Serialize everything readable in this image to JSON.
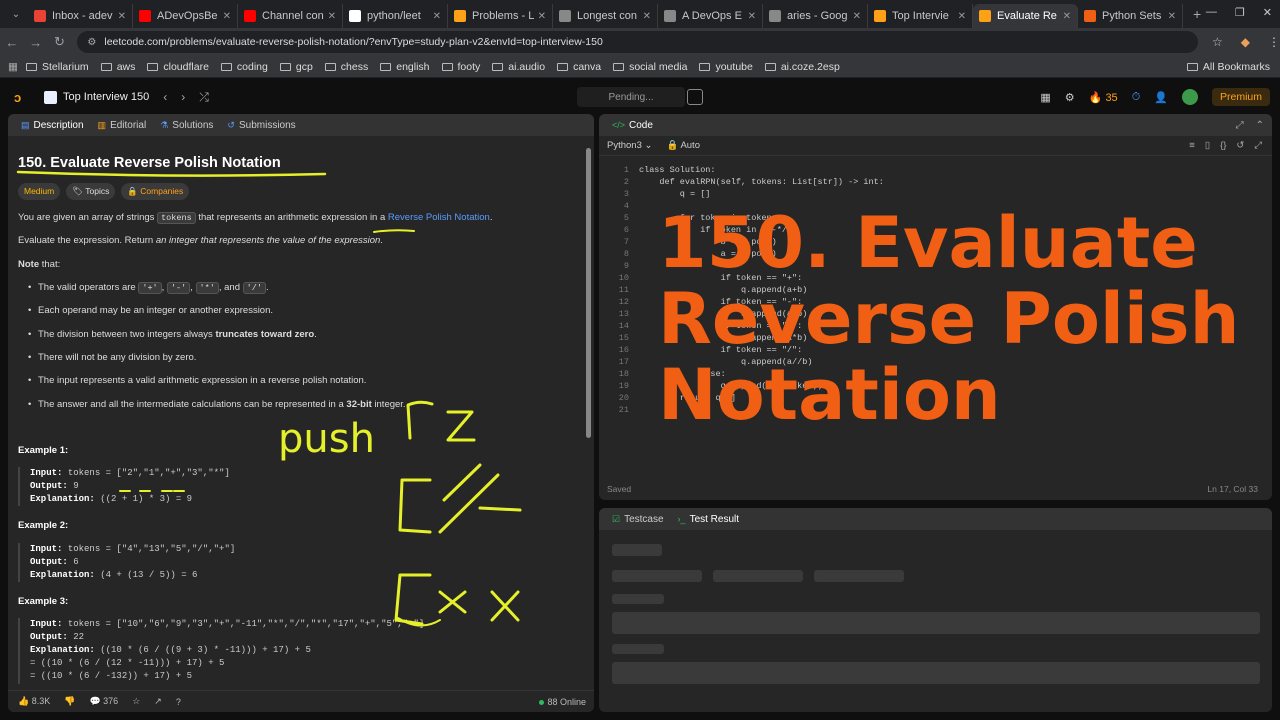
{
  "browser": {
    "tabs": [
      {
        "label": "Inbox - adev",
        "color": "#ea4335"
      },
      {
        "label": "ADevOpsBe",
        "color": "#ff0000"
      },
      {
        "label": "Channel con",
        "color": "#ff0000"
      },
      {
        "label": "python/leet",
        "color": "#ffffff"
      },
      {
        "label": "Problems - L",
        "color": "#ffa116"
      },
      {
        "label": "Longest con",
        "color": "#888888"
      },
      {
        "label": "A DevOps E",
        "color": "#888888"
      },
      {
        "label": "aries - Goog",
        "color": "#888888"
      },
      {
        "label": "Top Intervie",
        "color": "#ffa116"
      },
      {
        "label": "Evaluate Re",
        "color": "#ffa116",
        "active": true
      },
      {
        "label": "Python Sets",
        "color": "#f05f14"
      }
    ],
    "url": "leetcode.com/problems/evaluate-reverse-polish-notation/?envType=study-plan-v2&envId=top-interview-150",
    "bookmarks": [
      "Stellarium",
      "aws",
      "cloudflare",
      "coding",
      "gcp",
      "chess",
      "english",
      "footy",
      "ai.audio",
      "canva",
      "social media",
      "youtube",
      "ai.coze.2esp"
    ],
    "all_bookmarks": "All Bookmarks"
  },
  "lc_header": {
    "list_title": "Top Interview 150",
    "pending": "Pending...",
    "streak": "35",
    "premium": "Premium"
  },
  "desc_tabs": [
    "Description",
    "Editorial",
    "Solutions",
    "Submissions"
  ],
  "problem": {
    "title": "150. Evaluate Reverse Polish Notation",
    "difficulty": "Medium",
    "topics": "Topics",
    "companies": "Companies",
    "intro_a": "You are given an array of strings ",
    "intro_code": "tokens",
    "intro_b": " that represents an arithmetic expression in a ",
    "intro_link": "Reverse Polish Notation",
    "intro_c": ".",
    "eval_a": "Evaluate the expression. Return ",
    "eval_i": "an integer that represents the value of the expression",
    "eval_c": ".",
    "note_b": "Note",
    "note_rest": " that:",
    "ops_a": "The valid operators are ",
    "op1": "'+'",
    "op2": "'-'",
    "op3": "'*'",
    "ops_and": ", and ",
    "op4": "'/'",
    "bullet2": "Each operand may be an integer or another expression.",
    "bullet3_a": "The division between two integers always ",
    "bullet3_b": "truncates toward zero",
    "bullet3_c": ".",
    "bullet4": "There will not be any division by zero.",
    "bullet5": "The input represents a valid arithmetic expression in a reverse polish notation.",
    "bullet6_a": "The answer and all the intermediate calculations can be represented in a ",
    "bullet6_b": "32-bit",
    "bullet6_c": " integer.",
    "examples": [
      {
        "h": "Example 1:",
        "input": "tokens = [\"2\",\"1\",\"+\",\"3\",\"*\"]",
        "output": "9",
        "expl": "((2 + 1) * 3) = 9"
      },
      {
        "h": "Example 2:",
        "input": "tokens = [\"4\",\"13\",\"5\",\"/\",\"+\"]",
        "output": "6",
        "expl": "(4 + (13 / 5)) = 6"
      },
      {
        "h": "Example 3:",
        "input": "tokens = [\"10\",\"6\",\"9\",\"3\",\"+\",\"-11\",\"*\",\"/\",\"*\",\"17\",\"+\",\"5\",\"+\"]",
        "output": "22",
        "expl": "((10 * (6 / ((9 + 3) * -11))) + 17) + 5"
      }
    ],
    "ex3_more": [
      "= ((10 * (6 / (12 * -11))) + 17) + 5",
      "= ((10 * (6 / -132)) + 17) + 5"
    ],
    "label_input": "Input:",
    "label_output": "Output:",
    "label_expl": "Explanation:"
  },
  "footer": {
    "likes": "8.3K",
    "comments": "376",
    "online": "88 Online"
  },
  "code_panel": {
    "title": "Code",
    "language": "Python3",
    "auto": "Auto",
    "saved": "Saved",
    "cursor": "Ln 17, Col 33",
    "lines": [
      "class Solution:",
      "    def evalRPN(self, tokens: List[str]) -> int:",
      "        q = []",
      "",
      "        for token in tokens:",
      "            if token in \"+-*/\":",
      "                b = q.pop()",
      "                a = q.pop()",
      "",
      "                if token == \"+\":",
      "                    q.append(a+b)",
      "                if token == \"-\":",
      "                    q.append(a-b)",
      "                if token == \"*\":",
      "                    q.append(a*b)",
      "                if token == \"/\":",
      "                    q.append(a//b)",
      "            else:",
      "                q.append(int(token))",
      "        return q[0]",
      ""
    ]
  },
  "test_panel": {
    "tab1": "Testcase",
    "tab2": "Test Result"
  },
  "overlay_title": "150. Evaluate Reverse Polish Notation",
  "annotation": {
    "handwriting": "push"
  }
}
